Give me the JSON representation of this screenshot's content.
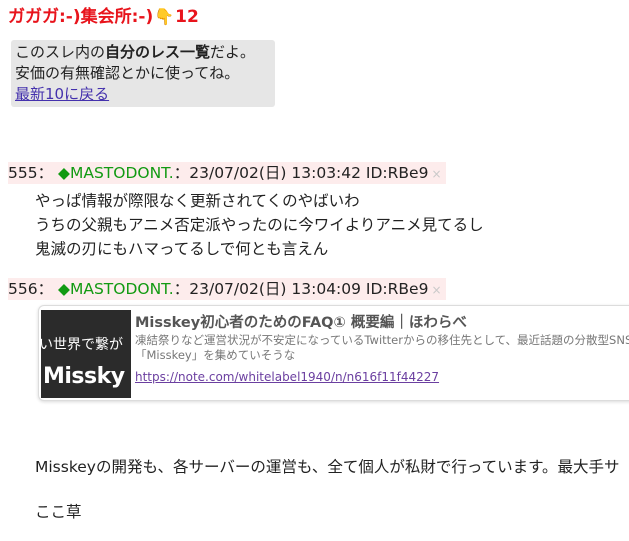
{
  "thread_title": {
    "before": "ガガガ:-)集会所:-)",
    "count": "12"
  },
  "notice": {
    "line1_pre": "このスレ内の",
    "line1_bold": "自分のレス一覧",
    "line1_post": "だよ。",
    "line2": "安価の有無確認とかに使ってね。",
    "link": "最新10に戻る"
  },
  "posts": [
    {
      "number": "555",
      "sep": "：",
      "name": "◆MASTODONT.",
      "date": "：23/07/02(日) 13:03:42 ID:RBe9",
      "delete": "×",
      "lines": [
        "やっぱ情報が際限なく更新されてくのやばいわ",
        "うちの父親もアニメ否定派やったのに今ワイよりアニメ見てるし",
        "鬼滅の刃にもハマってるしで何とも言えん"
      ]
    },
    {
      "number": "556",
      "sep": "：",
      "name": "◆MASTODONT.",
      "date": "：23/07/02(日) 13:04:09 ID:RBe9",
      "delete": "×",
      "card": {
        "thumb_text1": "い世界で繋が",
        "thumb_text2": "Missky",
        "title": "Misskey初心者のためのFAQ① 概要編｜ほわらべ",
        "description": "凍結祭りなど運営状況が不安定になっているTwitterからの移住先として、最近話題の分散型SNS「Misskey」を集めていそうな",
        "url": "https://note.com/whitelabel1940/n/n616f11f44227"
      },
      "lines": [
        "Misskeyの開発も、各サーバーの運営も、全て個人が私財で行っています。最大手サ",
        "ここ草"
      ]
    }
  ]
}
